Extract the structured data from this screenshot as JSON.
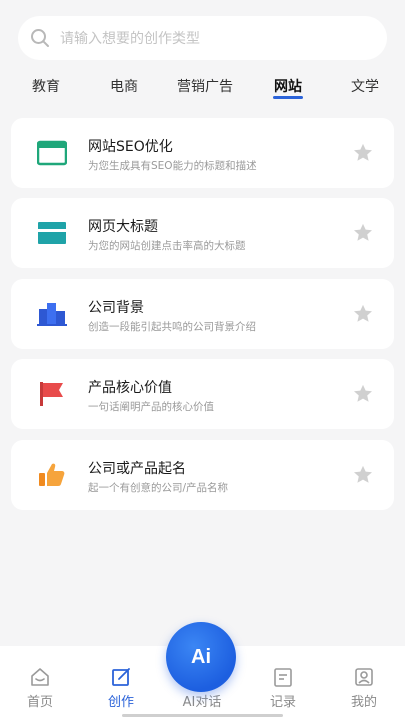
{
  "search": {
    "placeholder": "请输入想要的创作类型",
    "icon": "search-icon"
  },
  "tabs": [
    {
      "label": "教育",
      "active": false
    },
    {
      "label": "电商",
      "active": false
    },
    {
      "label": "营销广告",
      "active": false
    },
    {
      "label": "网站",
      "active": true
    },
    {
      "label": "文学",
      "active": false
    }
  ],
  "cards": [
    {
      "title": "网站SEO优化",
      "desc": "为您生成具有SEO能力的标题和描述",
      "icon": "browser-window-icon",
      "color": "#1fa77a"
    },
    {
      "title": "网页大标题",
      "desc": "为您的网站创建点击率高的大标题",
      "icon": "webpage-icon",
      "color": "#1fa3a8"
    },
    {
      "title": "公司背景",
      "desc": "创造一段能引起共鸣的公司背景介绍",
      "icon": "building-icon",
      "color": "#2e58d3"
    },
    {
      "title": "产品核心价值",
      "desc": "一句话阐明产品的核心价值",
      "icon": "flag-icon",
      "color": "#e84b4b"
    },
    {
      "title": "公司或产品起名",
      "desc": "起一个有创意的公司/产品名称",
      "icon": "thumbs-up-icon",
      "color": "#f08a1f"
    }
  ],
  "tabbar": {
    "items": [
      {
        "label": "首页",
        "active": false,
        "icon": "home-icon"
      },
      {
        "label": "创作",
        "active": true,
        "icon": "edit-icon"
      },
      {
        "label": "AI对话",
        "active": false,
        "icon": "ai-icon"
      },
      {
        "label": "记录",
        "active": false,
        "icon": "record-icon"
      },
      {
        "label": "我的",
        "active": false,
        "icon": "profile-icon"
      }
    ],
    "ai_button_text": "Ai"
  },
  "colors": {
    "accent": "#2b63d9",
    "star": "#d0d0d0",
    "background": "#f5f5f6"
  }
}
